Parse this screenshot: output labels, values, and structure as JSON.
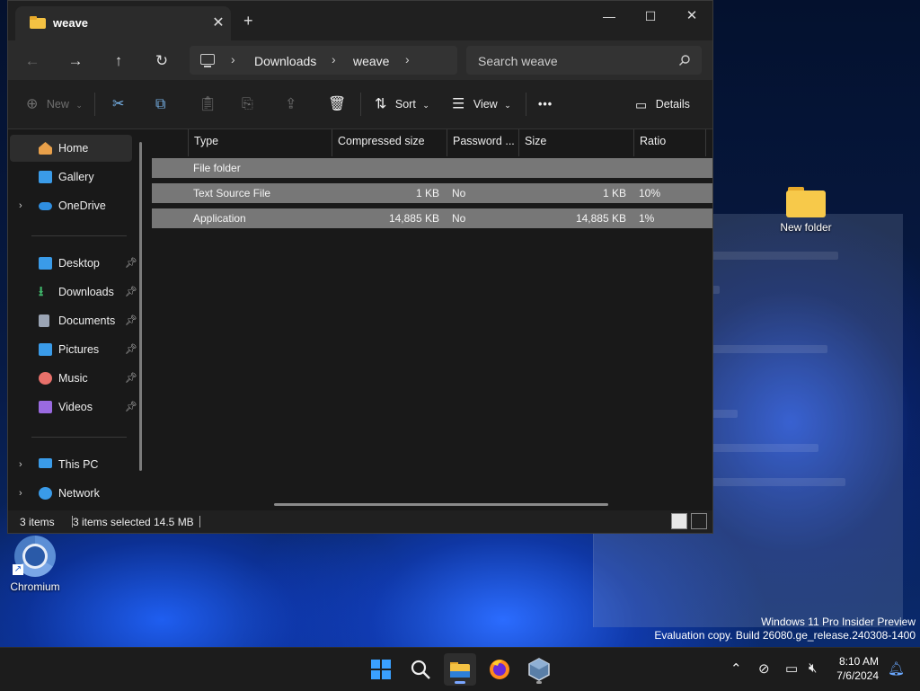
{
  "window": {
    "tab_title": "weave",
    "tab_close": "✕",
    "new_tab": "+",
    "minimize": "—",
    "maximize": "☐",
    "close": "✕"
  },
  "nav": {
    "crumbs": [
      "Downloads",
      "weave"
    ],
    "chevron": "›",
    "search_placeholder": "Search weave",
    "icons": [
      "back-icon",
      "forward-icon",
      "up-icon",
      "refresh-icon",
      "search-icon"
    ]
  },
  "toolbar": {
    "new_label": "New",
    "sort_label": "Sort",
    "view_label": "View",
    "more_label": "•••",
    "details_label": "Details"
  },
  "sidebar": {
    "items": [
      {
        "label": "Home",
        "icon": "home-icon",
        "color": "#e8a04a"
      },
      {
        "label": "Gallery",
        "icon": "gallery-icon",
        "color": "#3a9be8"
      },
      {
        "label": "OneDrive",
        "icon": "cloud-icon",
        "color": "#2f8ee0"
      },
      {
        "label": "Desktop",
        "icon": "desktop-icon",
        "color": "#3a9be8"
      },
      {
        "label": "Downloads",
        "icon": "download-icon",
        "color": "#3fb56a"
      },
      {
        "label": "Documents",
        "icon": "documents-icon",
        "color": "#9aa4b4"
      },
      {
        "label": "Pictures",
        "icon": "pictures-icon",
        "color": "#3a9be8"
      },
      {
        "label": "Music",
        "icon": "music-icon",
        "color": "#e8706a"
      },
      {
        "label": "Videos",
        "icon": "videos-icon",
        "color": "#9a6ae0"
      },
      {
        "label": "This PC",
        "icon": "pc-icon",
        "color": "#3a9be8"
      },
      {
        "label": "Network",
        "icon": "network-icon",
        "color": "#3a9be8"
      }
    ]
  },
  "files": {
    "columns": [
      "Type",
      "Compressed size",
      "Password ...",
      "Size",
      "Ratio"
    ],
    "rows": [
      {
        "type": "File folder",
        "compressed": "",
        "password": "",
        "size": "",
        "ratio": ""
      },
      {
        "type": "Text Source File",
        "compressed": "1 KB",
        "password": "No",
        "size": "1 KB",
        "ratio": "10%"
      },
      {
        "type": "Application",
        "compressed": "14,885 KB",
        "password": "No",
        "size": "14,885 KB",
        "ratio": "1%"
      }
    ]
  },
  "status": {
    "items_count": "3 items",
    "selected": "3 items selected",
    "selected_size": "14.5 MB"
  },
  "desktop": {
    "new_folder_label": "New folder",
    "chromium_label": "Chromium",
    "watermark_line1": "Windows 11 Pro Insider Preview",
    "watermark_line2": "Evaluation copy. Build 26080.ge_release.240308-1400"
  },
  "taskbar": {
    "time": "8:10 AM",
    "date": "7/6/2024",
    "apps": [
      "start-icon",
      "search-icon",
      "file-explorer-icon",
      "firefox-icon",
      "virtualbox-icon"
    ]
  },
  "colors": {
    "accent": "#7aa6ff",
    "selection_row": "#777777",
    "window_bg": "#191919"
  }
}
